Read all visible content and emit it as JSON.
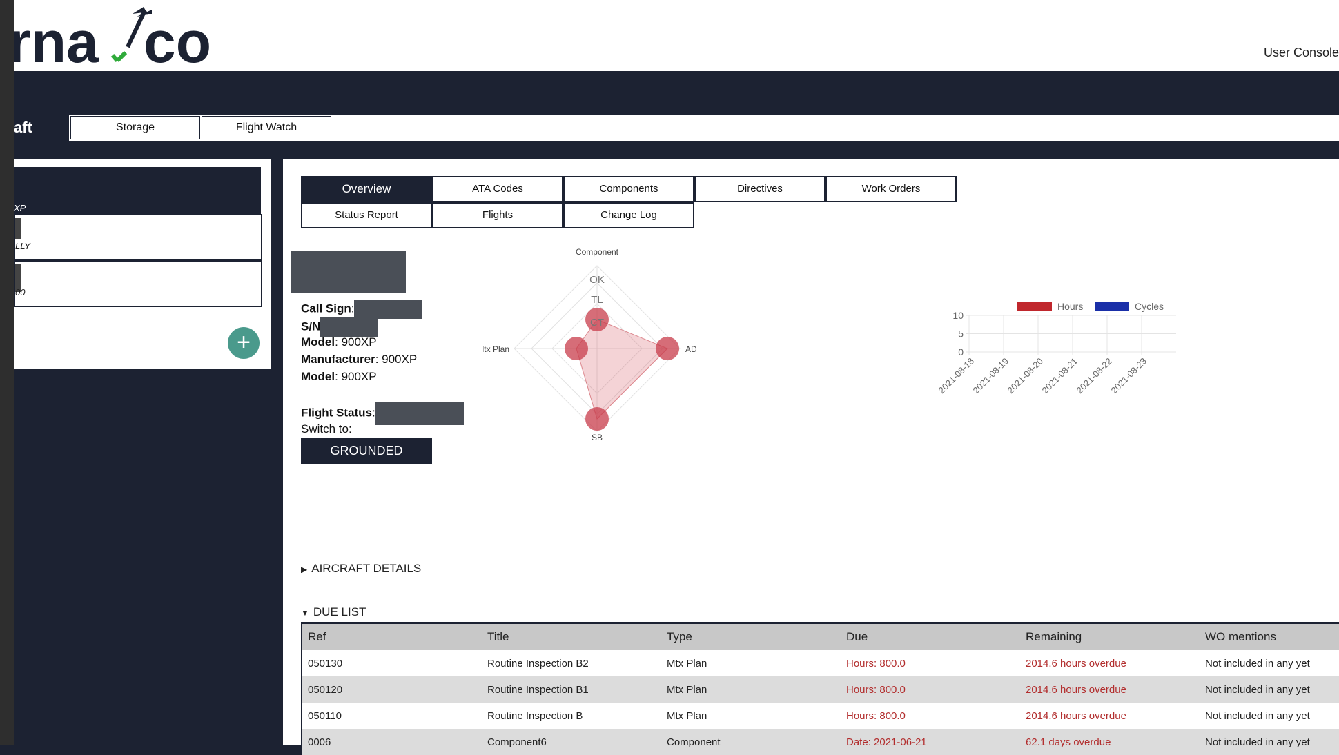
{
  "header": {
    "logo_text": "rnavco",
    "user_console": "User Console"
  },
  "top_nav": {
    "current_section": "aft",
    "tabs": [
      "Storage",
      "Flight Watch"
    ]
  },
  "left_panel": {
    "header_label": "XP",
    "items": [
      {
        "label": "LLY"
      },
      {
        "label": "00"
      }
    ],
    "add_button": "+"
  },
  "tabs": {
    "row1": [
      "Overview",
      "ATA Codes",
      "Components",
      "Directives",
      "Work Orders"
    ],
    "row2": [
      "Status Report",
      "Flights",
      "Change Log"
    ],
    "active": "Overview"
  },
  "aircraft_info": {
    "call_sign_label": "Call Sign",
    "sn_label": "S/N",
    "model_label": "Model",
    "model_value": "900XP",
    "manufacturer_label": "Manufacturer",
    "manufacturer_value": "900XP",
    "model2_label": "Model",
    "model2_value": "900XP",
    "flight_status_label": "Flight Status",
    "switch_to_label": "Switch to:",
    "grounded_button": "GROUNDED"
  },
  "radar_chart": {
    "axes": {
      "top": "Component",
      "right": "AD",
      "bottom": "SB",
      "left": "Mtx Plan"
    },
    "rings": [
      "OK",
      "TL",
      "CT"
    ],
    "values": {
      "top": 0.35,
      "right": 0.85,
      "bottom": 0.85,
      "left": 0.25
    }
  },
  "chart_data": {
    "type": "line",
    "title": "",
    "x": [
      "2021-08-18",
      "2021-08-19",
      "2021-08-20",
      "2021-08-21",
      "2021-08-22",
      "2021-08-23"
    ],
    "series": [
      {
        "name": "Hours",
        "values": [],
        "color": "#c0272d"
      },
      {
        "name": "Cycles",
        "values": [],
        "color": "#1a2fa8"
      }
    ],
    "y_ticks": [
      0,
      5,
      10
    ],
    "ylim": [
      0,
      10
    ],
    "legend": "top"
  },
  "sections": {
    "aircraft_details": "AIRCRAFT DETAILS",
    "due_list": "DUE LIST"
  },
  "due_list": {
    "columns": [
      "Ref",
      "Title",
      "Type",
      "Due",
      "Remaining",
      "WO mentions"
    ],
    "rows": [
      {
        "ref": "050130",
        "title": "Routine Inspection B2",
        "type": "Mtx Plan",
        "due": "Hours: 800.0",
        "remaining": "2014.6 hours overdue",
        "wo": "Not included in any yet"
      },
      {
        "ref": "050120",
        "title": "Routine Inspection B1",
        "type": "Mtx Plan",
        "due": "Hours: 800.0",
        "remaining": "2014.6 hours overdue",
        "wo": "Not included in any yet"
      },
      {
        "ref": "050110",
        "title": "Routine Inspection B",
        "type": "Mtx Plan",
        "due": "Hours: 800.0",
        "remaining": "2014.6 hours overdue",
        "wo": "Not included in any yet"
      },
      {
        "ref": "0006",
        "title": "Component6",
        "type": "Component",
        "due": "Date: 2021-06-21",
        "remaining": "62.1 days overdue",
        "wo": "Not included in any yet"
      }
    ]
  }
}
